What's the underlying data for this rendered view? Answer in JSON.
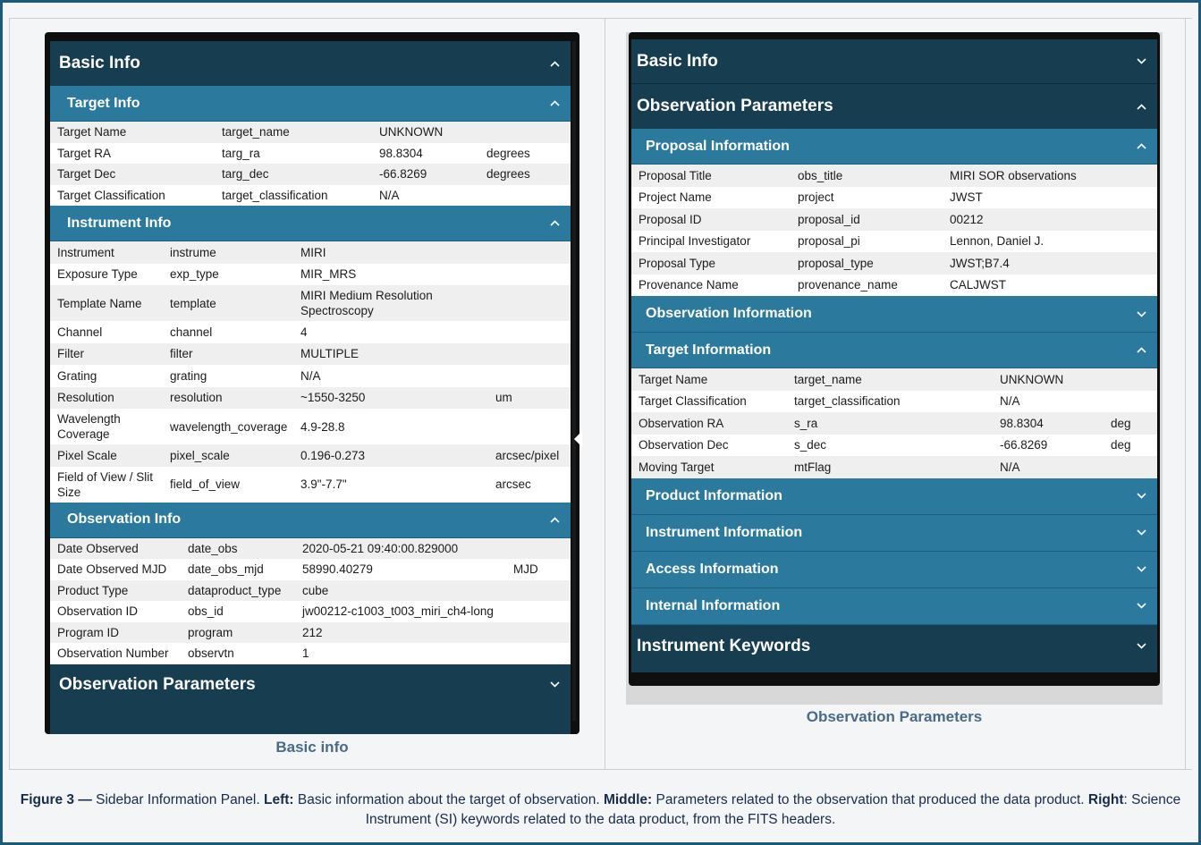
{
  "left_panel": {
    "title": "Basic Info",
    "sections": [
      {
        "title": "Target Info",
        "rows": [
          [
            "Target Name",
            "target_name",
            "UNKNOWN",
            ""
          ],
          [
            "Target RA",
            "targ_ra",
            "98.8304",
            "degrees"
          ],
          [
            "Target Dec",
            "targ_dec",
            "-66.8269",
            "degrees"
          ],
          [
            "Target Classification",
            "target_classification",
            "N/A",
            ""
          ]
        ]
      },
      {
        "title": "Instrument Info",
        "rows": [
          [
            "Instrument",
            "instrume",
            "MIRI",
            ""
          ],
          [
            "Exposure Type",
            "exp_type",
            "MIR_MRS",
            ""
          ],
          [
            "Template Name",
            "template",
            "MIRI Medium Resolution Spectroscopy",
            ""
          ],
          [
            "Channel",
            "channel",
            "4",
            ""
          ],
          [
            "Filter",
            "filter",
            "MULTIPLE",
            ""
          ],
          [
            "Grating",
            "grating",
            "N/A",
            ""
          ],
          [
            "Resolution",
            "resolution",
            "~1550-3250",
            "um"
          ],
          [
            "Wavelength Coverage",
            "wavelength_coverage",
            "4.9-28.8",
            ""
          ],
          [
            "Pixel Scale",
            "pixel_scale",
            "0.196-0.273",
            "arcsec/pixel"
          ],
          [
            "Field of View / Slit Size",
            "field_of_view",
            "3.9\"-7.7\"",
            "arcsec"
          ]
        ]
      },
      {
        "title": "Observation Info",
        "rows": [
          [
            "Date Observed",
            "date_obs",
            "2020-05-21 09:40:00.829000",
            ""
          ],
          [
            "Date Observed MJD",
            "date_obs_mjd",
            "58990.40279",
            "MJD"
          ],
          [
            "Product Type",
            "dataproduct_type",
            "cube",
            ""
          ],
          [
            "Observation ID",
            "obs_id",
            "jw00212-c1003_t003_miri_ch4-long",
            ""
          ],
          [
            "Program ID",
            "program",
            "212",
            ""
          ],
          [
            "Observation Number",
            "observtn",
            "1",
            ""
          ]
        ]
      }
    ],
    "footer_title": "Observation Parameters",
    "caption": "Basic info"
  },
  "right_panel": {
    "top_title": "Basic Info",
    "title": "Observation Parameters",
    "proposal": {
      "title": "Proposal Information",
      "rows": [
        [
          "Proposal Title",
          "obs_title",
          "MIRI SOR observations",
          ""
        ],
        [
          "Project Name",
          "project",
          "JWST",
          ""
        ],
        [
          "Proposal ID",
          "proposal_id",
          "00212",
          ""
        ],
        [
          "Principal Investigator",
          "proposal_pi",
          "Lennon, Daniel J.",
          ""
        ],
        [
          "Proposal Type",
          "proposal_type",
          "JWST;B7.4",
          ""
        ],
        [
          "Provenance Name",
          "provenance_name",
          "CALJWST",
          ""
        ]
      ]
    },
    "observation_info_title": "Observation Information",
    "target": {
      "title": "Target Information",
      "rows": [
        [
          "Target Name",
          "target_name",
          "UNKNOWN",
          ""
        ],
        [
          "Target Classification",
          "target_classification",
          "N/A",
          ""
        ],
        [
          "Observation RA",
          "s_ra",
          "98.8304",
          "deg"
        ],
        [
          "Observation Dec",
          "s_dec",
          "-66.8269",
          "deg"
        ],
        [
          "Moving Target",
          "mtFlag",
          "N/A",
          ""
        ]
      ]
    },
    "collapsed_sections": [
      "Product Information",
      "Instrument Information",
      "Access Information",
      "Internal Information"
    ],
    "footer_title": "Instrument Keywords",
    "caption": "Observation Parameters"
  },
  "figure_caption": {
    "lead": "Figure 3 —",
    "text1": " Sidebar Information Panel. ",
    "left_label": "Left:",
    "text2": " Basic information about the target of observation. ",
    "middle_label": "Middle:",
    "text3": " Parameters related to the observation that produced the data product. ",
    "right_label": "Right",
    "text4": ": Science Instrument (SI) keywords related to the data product, from the FITS headers."
  },
  "colors": {
    "header_dark": "#173d51",
    "header_sub": "#2b7a9e",
    "frame_border": "#1d5a7a",
    "caption_text": "#4a6a8a"
  },
  "icons": {
    "expanded": "chevron-up-icon",
    "collapsed": "chevron-down-icon"
  }
}
